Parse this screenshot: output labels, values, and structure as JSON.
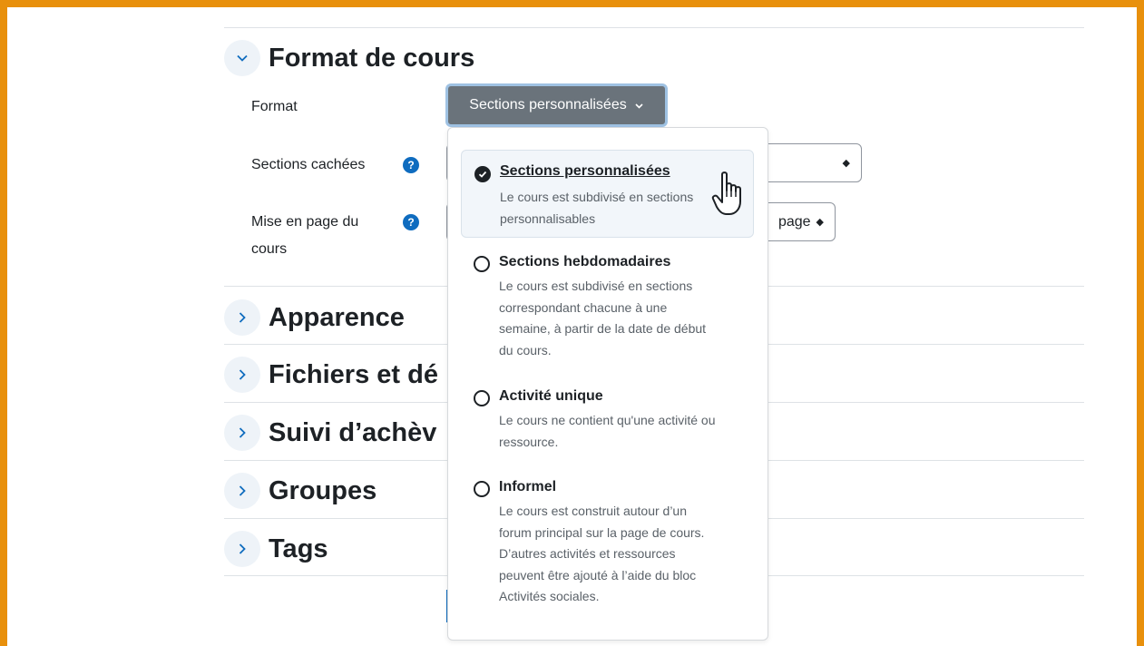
{
  "sections": [
    {
      "title": "Format de cours",
      "expanded": true
    },
    {
      "title": "Apparence",
      "expanded": false
    },
    {
      "title": "Fichiers et dé",
      "expanded": false
    },
    {
      "title": "Suivi d’achèv",
      "expanded": false
    },
    {
      "title": "Groupes",
      "expanded": false
    },
    {
      "title": "Tags",
      "expanded": false
    }
  ],
  "fields": {
    "format_label": "Format",
    "hidden_sections_label": "Sections cachées",
    "layout_label_line1": "Mise en page du",
    "layout_label_line2": "cours",
    "layout_value_visible": "page",
    "help_glyph": "?"
  },
  "format_button": {
    "label": "Sections personnalisées",
    "icon": "chevron-down-icon"
  },
  "dropdown": {
    "options": [
      {
        "title": "Sections personnalisées",
        "desc_lines": [
          "Le cours est subdivisé en sections",
          "personnalisables"
        ],
        "selected": true
      },
      {
        "title": "Sections hebdomadaires",
        "desc_lines": [
          "Le cours est subdivisé en sections",
          "correspondant chacune à une",
          "semaine, à partir de la date de début",
          "du cours."
        ],
        "selected": false
      },
      {
        "title": "Activité unique",
        "desc_lines": [
          "Le cours ne contient qu'une activité ou",
          "ressource."
        ],
        "selected": false
      },
      {
        "title": "Informel",
        "desc_lines": [
          "Le cours est construit autour d’un",
          "forum principal sur la page de cours.",
          "D’autres activités et ressources",
          "peuvent être ajouté à l’aide du bloc",
          "Activités sociales."
        ],
        "selected": false
      }
    ]
  },
  "colors": {
    "frame": "#e8900c",
    "accent": "#0f6cbf",
    "button_bg": "#6a737b"
  }
}
